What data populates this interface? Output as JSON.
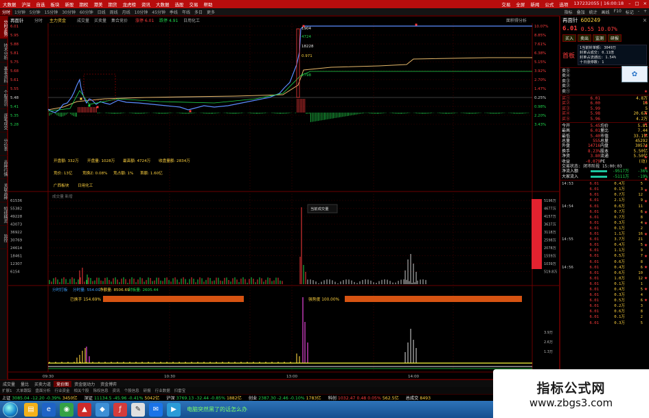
{
  "topbar": {
    "menus": [
      "大数据",
      "沪深",
      "自选",
      "板块",
      "新股",
      "期权",
      "港美",
      "期货",
      "龙虎榜",
      "资讯",
      "大数据",
      "选股",
      "交易",
      "帮助"
    ],
    "right": [
      "交易",
      "全屏",
      "新闻",
      "公式",
      "选项"
    ],
    "clock": "137232055 | 16:00:18"
  },
  "timeframes": [
    "分时",
    "1分钟",
    "5分钟",
    "15分钟",
    "30分钟",
    "60分钟",
    "日线",
    "周线",
    "月线",
    "10分钟",
    "45分钟",
    "季线",
    "年线",
    "多日",
    "更多"
  ],
  "timeframe_active": "分时",
  "tf_right": [
    "指标",
    "叠加",
    "统计",
    "画线",
    "F10",
    "标记",
    "-",
    "+"
  ],
  "vtabs": [
    "分时走势",
    "技术分析",
    "基本资料",
    "个股资讯",
    "逐笔成交",
    "分价表",
    "品种行情",
    "关联品种",
    "短线精灵",
    "监控"
  ],
  "chart": {
    "stock_title": "再面针",
    "title_items": [
      "分时",
      "主力资金",
      "成交量",
      "买卖量",
      "集合竞价",
      "涨停 6.01",
      "跌停 4.91",
      "日用化工"
    ],
    "score_label": "面积得分析",
    "price_levels_left": [
      "6.01",
      "5.95",
      "5.88",
      "5.81",
      "5.75",
      "5.68",
      "5.61",
      "5.55",
      "5.48",
      "5.41",
      "5.35",
      "5.28"
    ],
    "pct_levels_right": [
      "10.07%",
      "8.85%",
      "7.61%",
      "6.38%",
      "5.15%",
      "3.92%",
      "2.70%",
      "1.47%",
      "0.25%",
      "0.98%",
      "2.20%",
      "3.43%"
    ],
    "float_labels": [
      "1904",
      "4724",
      "18228",
      "0.971",
      "1798"
    ],
    "annot_row1": [
      "开盘额: 332万",
      "开盘量: 1028万",
      "最高额: 4724万",
      "收盘量额: 2834万"
    ],
    "annot_row2": [
      "竞价: 13亿",
      "竞换Z: 0.08%",
      "竞占额: 1%",
      "首额: 1.60亿"
    ],
    "annot_row3": [
      "广西板块",
      "日用化工"
    ],
    "vol_label": "成交量 新增 ",
    "vol_tooltip": "当前成交量",
    "vol_levels_left": [
      "61536",
      "55382",
      "49228",
      "43073",
      "36922",
      "30769",
      "24614",
      "18461",
      "12307",
      "6154"
    ],
    "vol_levels_right": [
      "5196万",
      "4677万",
      "4157万",
      "3637万",
      "3118万",
      "2598万",
      "2078万",
      "1559万",
      "1039万",
      "519.8万"
    ],
    "bottom_title": "分时打板",
    "bottom_items": [
      "分时量: 554.00",
      "净额量: 8506.69",
      "封板量: 2605.44"
    ],
    "bar1_label": "已换手 154.69%",
    "bar2_label": "强势度 100.00%",
    "bottom_levels_right": [
      "3.9万",
      "2.6万",
      "1.3万"
    ],
    "time_ticks": [
      "09:30",
      "10:30",
      "13:00",
      "14:00"
    ]
  },
  "quote": {
    "name": "再面针",
    "code": "600249",
    "price": "6.01",
    "change": "0.55",
    "change_pct": "10.07%",
    "buttons": [
      "买入",
      "卖出",
      "监测",
      "研报"
    ],
    "tag": "首板",
    "info": [
      "1当前封单额: 3049万",
      "封单占成交: 0.11倍",
      "封单占流通比: 1.54%",
      "十日涨停数: 1"
    ],
    "sell_rows": [
      [
        "卖⑤",
        "",
        "",
        ""
      ],
      [
        "卖④",
        "",
        "",
        ""
      ],
      [
        "卖③",
        "",
        "",
        ""
      ],
      [
        "卖②",
        "",
        "",
        ""
      ],
      [
        "卖①",
        "",
        "",
        ""
      ]
    ],
    "buy_rows": [
      [
        "买①",
        "6.01",
        "",
        "4.8万"
      ],
      [
        "买②",
        "6.00",
        "",
        "16"
      ],
      [
        "买③",
        "5.99",
        "",
        "5"
      ],
      [
        "买④",
        "5.98",
        "",
        "20.6万"
      ],
      [
        "买⑤",
        "5.96",
        "",
        "4.2万"
      ]
    ],
    "stats": [
      [
        "今开",
        "5.45",
        "均价",
        "5.81"
      ],
      [
        "最高",
        "6.01",
        "量比",
        "7.44"
      ],
      [
        "最低",
        "5.40",
        "市值",
        "33.1亿"
      ],
      [
        "总量",
        "555",
        "总量",
        "45292"
      ],
      [
        "外盘",
        "14716",
        "内盘",
        "30574"
      ],
      [
        "换手",
        "8.23%",
        "股本",
        "5.50亿"
      ],
      [
        "净资",
        "3.80",
        "流通",
        "5.50亿"
      ],
      [
        "收益",
        "-0.079",
        "PE",
        "(动)"
      ]
    ],
    "status": "交易状态: 闭市阶段 15:00:03",
    "flow": [
      [
        "净流入额",
        "-9517万",
        "-36%"
      ],
      [
        "大家流入",
        "-5111万",
        "-19%"
      ]
    ],
    "ticks": [
      [
        "14:53",
        "6.01",
        "0.4万",
        "5"
      ],
      [
        "",
        "6.01",
        "0.1万",
        "3"
      ],
      [
        "",
        "6.01",
        "0.7万",
        "12"
      ],
      [
        "",
        "6.01",
        "2.1万",
        "9"
      ],
      [
        "14:54",
        "6.01",
        "0.6万",
        "11"
      ],
      [
        "",
        "6.01",
        "0.7万",
        "6"
      ],
      [
        "",
        "6.01",
        "0.7万",
        "8"
      ],
      [
        "",
        "6.01",
        "0.3万",
        "4"
      ],
      [
        "",
        "6.01",
        "0.1万",
        "2"
      ],
      [
        "",
        "6.01",
        "1.1万",
        "16"
      ],
      [
        "14:55",
        "6.01",
        "3.7万",
        "21"
      ],
      [
        "",
        "6.01",
        "0.4万",
        "5"
      ],
      [
        "",
        "6.01",
        "1.1万",
        "9"
      ],
      [
        "",
        "6.01",
        "0.5万",
        "7"
      ],
      [
        "",
        "6.01",
        "0.6万",
        "8"
      ],
      [
        "14:56",
        "6.01",
        "0.4万",
        "6"
      ],
      [
        "",
        "6.01",
        "0.6万",
        "10"
      ],
      [
        "",
        "6.01",
        "1.0万",
        "12"
      ],
      [
        "",
        "6.01",
        "0.1万",
        "1"
      ],
      [
        "",
        "6.01",
        "0.4万",
        "5"
      ],
      [
        "",
        "6.01",
        "0.3万",
        "4"
      ],
      [
        "",
        "6.01",
        "0.5万",
        "6"
      ],
      [
        "",
        "6.01",
        "0.2万",
        "3"
      ],
      [
        "",
        "6.01",
        "0.6万",
        "8"
      ],
      [
        "",
        "6.01",
        "0.1万",
        "2"
      ],
      [
        "",
        "6.01",
        "0.3万",
        "5"
      ]
    ]
  },
  "bottomtabs": [
    "成交量",
    "量比",
    "买卖力道",
    "竞价图",
    "资金驱动力",
    "资金博弈"
  ],
  "bottomtabs2": [
    "扩展1",
    "大单跟踪",
    "盘面分析",
    "行业资金",
    "相关个股",
    "除权信息",
    "资讯",
    "个股信息",
    "研报",
    "行业数据",
    "扫雷宝"
  ],
  "indices": [
    {
      "name": "上证",
      "val": "3085.04",
      "chg": "-12.20",
      "pct": "-0.39%",
      "amt": "3450亿"
    },
    {
      "name": "深证",
      "val": "11134.5",
      "chg": "-45.96",
      "pct": "-0.41%",
      "amt": "5042亿"
    },
    {
      "name": "沪深",
      "val": "3769.13",
      "chg": "-32.44",
      "pct": "-0.85%",
      "amt": "1882亿"
    },
    {
      "name": "创业",
      "val": "2387.30",
      "chg": "-2.46",
      "pct": "-0.10%",
      "amt": "1783亿"
    },
    {
      "name": "科创",
      "val": "1032.47",
      "chg": "0.48",
      "pct": "0.05%",
      "amt": "562.5亿"
    },
    {
      "name": "总成交",
      "val": "8493",
      "chg": "",
      "pct": "",
      "amt": ""
    }
  ],
  "taskbar_text": "电脑突然黑了的话怎么办",
  "watermark": {
    "line1": "指标公式网",
    "line2": "www.zbgs3.com"
  },
  "colors": {
    "red": "#ff3c3c",
    "green": "#21d84d",
    "yellow": "#ffd23f",
    "white_line": "#e8e8e8",
    "avg_line": "#e6b86a",
    "brand": "#b80d0d"
  }
}
